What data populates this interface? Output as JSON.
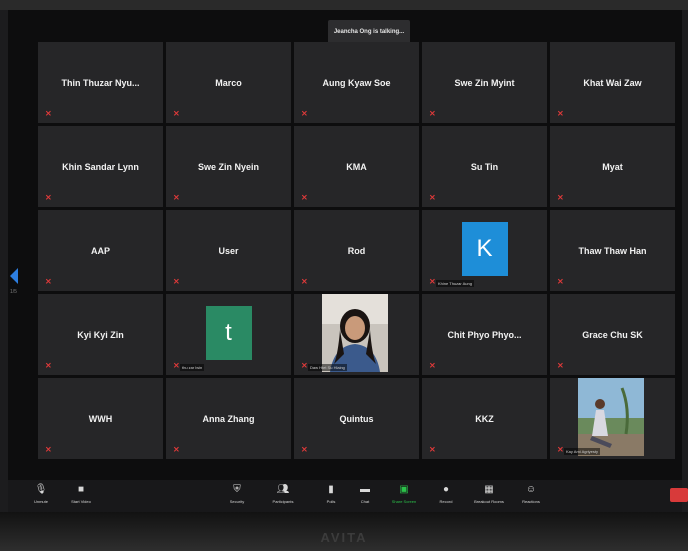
{
  "banner": {
    "speaker_text": "Jeancha Ong is talking..."
  },
  "participants": [
    {
      "name": "Thin Thuzar Nyu...",
      "label": ""
    },
    {
      "name": "Marco",
      "label": ""
    },
    {
      "name": "Aung Kyaw Soe",
      "label": ""
    },
    {
      "name": "Swe Zin Myint",
      "label": ""
    },
    {
      "name": "Khat Wai Zaw",
      "label": ""
    },
    {
      "name": "Khin Sandar Lynn",
      "label": ""
    },
    {
      "name": "Swe Zin Nyein",
      "label": ""
    },
    {
      "name": "KMA",
      "label": ""
    },
    {
      "name": "Su Tin",
      "label": ""
    },
    {
      "name": "Myat",
      "label": ""
    },
    {
      "name": "AAP",
      "label": ""
    },
    {
      "name": "User",
      "label": ""
    },
    {
      "name": "Rod",
      "label": ""
    },
    {
      "name": "",
      "avatar_letter": "K",
      "avatar_color": "#1e8ed8",
      "label": "Khine Thuzar Aung"
    },
    {
      "name": "Thaw Thaw Han",
      "label": ""
    },
    {
      "name": "Kyi Kyi Zin",
      "label": ""
    },
    {
      "name": "",
      "avatar_letter": "t",
      "avatar_color": "#2a8a64",
      "label": "thu zar lwin"
    },
    {
      "name": "",
      "photo": "woman-photo",
      "label": "Daw Htet Su Hlaing"
    },
    {
      "name": "Chit Phyo Phyo...",
      "label": ""
    },
    {
      "name": "Grace Chu SK",
      "label": ""
    },
    {
      "name": "WWH",
      "label": ""
    },
    {
      "name": "Anna Zhang",
      "label": ""
    },
    {
      "name": "Quintus",
      "label": ""
    },
    {
      "name": "KKZ",
      "label": ""
    },
    {
      "name": "",
      "photo": "outdoor-photo",
      "label": "Kay Ami Agriyesty"
    }
  ],
  "sidebar": {
    "page_indicator": "1/5"
  },
  "toolbar": {
    "unmute": "Unmute",
    "start_video": "Start Video",
    "security": "Security",
    "participants": "Participants",
    "participants_count": "25",
    "polls": "Polls",
    "chat": "Chat",
    "share_screen": "Share Screen",
    "record": "Record",
    "breakout_rooms": "Breakout Rooms",
    "reactions": "Reactions"
  },
  "monitor": {
    "brand": "AVITA"
  },
  "colors": {
    "accent_blue": "#2d7ee0",
    "share_green": "#2bc24a",
    "mute_red": "#e23a3a",
    "end_red": "#d83a3a"
  }
}
